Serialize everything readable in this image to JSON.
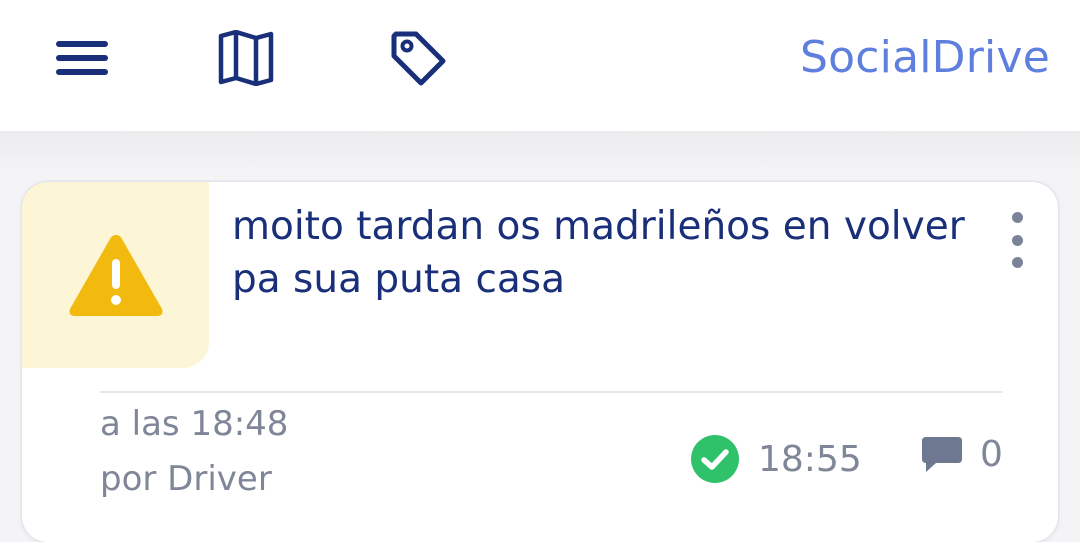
{
  "header": {
    "menu_icon": "hamburger-icon",
    "map_icon": "map-icon",
    "tag_icon": "tag-icon",
    "brand": "SocialDrive",
    "brand_color": "#5f7fde",
    "icon_color": "#1a2f7a"
  },
  "alert": {
    "icon": "warning-triangle-icon",
    "icon_color": "#f2b90f",
    "message": "moito tardan os madrileños en volver pa sua puta casa",
    "time_text": "a las 18:48",
    "author_text": "por Driver",
    "resolved_icon": "check-circle-icon",
    "resolved_color": "#2fc26b",
    "resolved_time": "18:55",
    "comments_icon": "comment-icon",
    "comments_count": "0"
  }
}
